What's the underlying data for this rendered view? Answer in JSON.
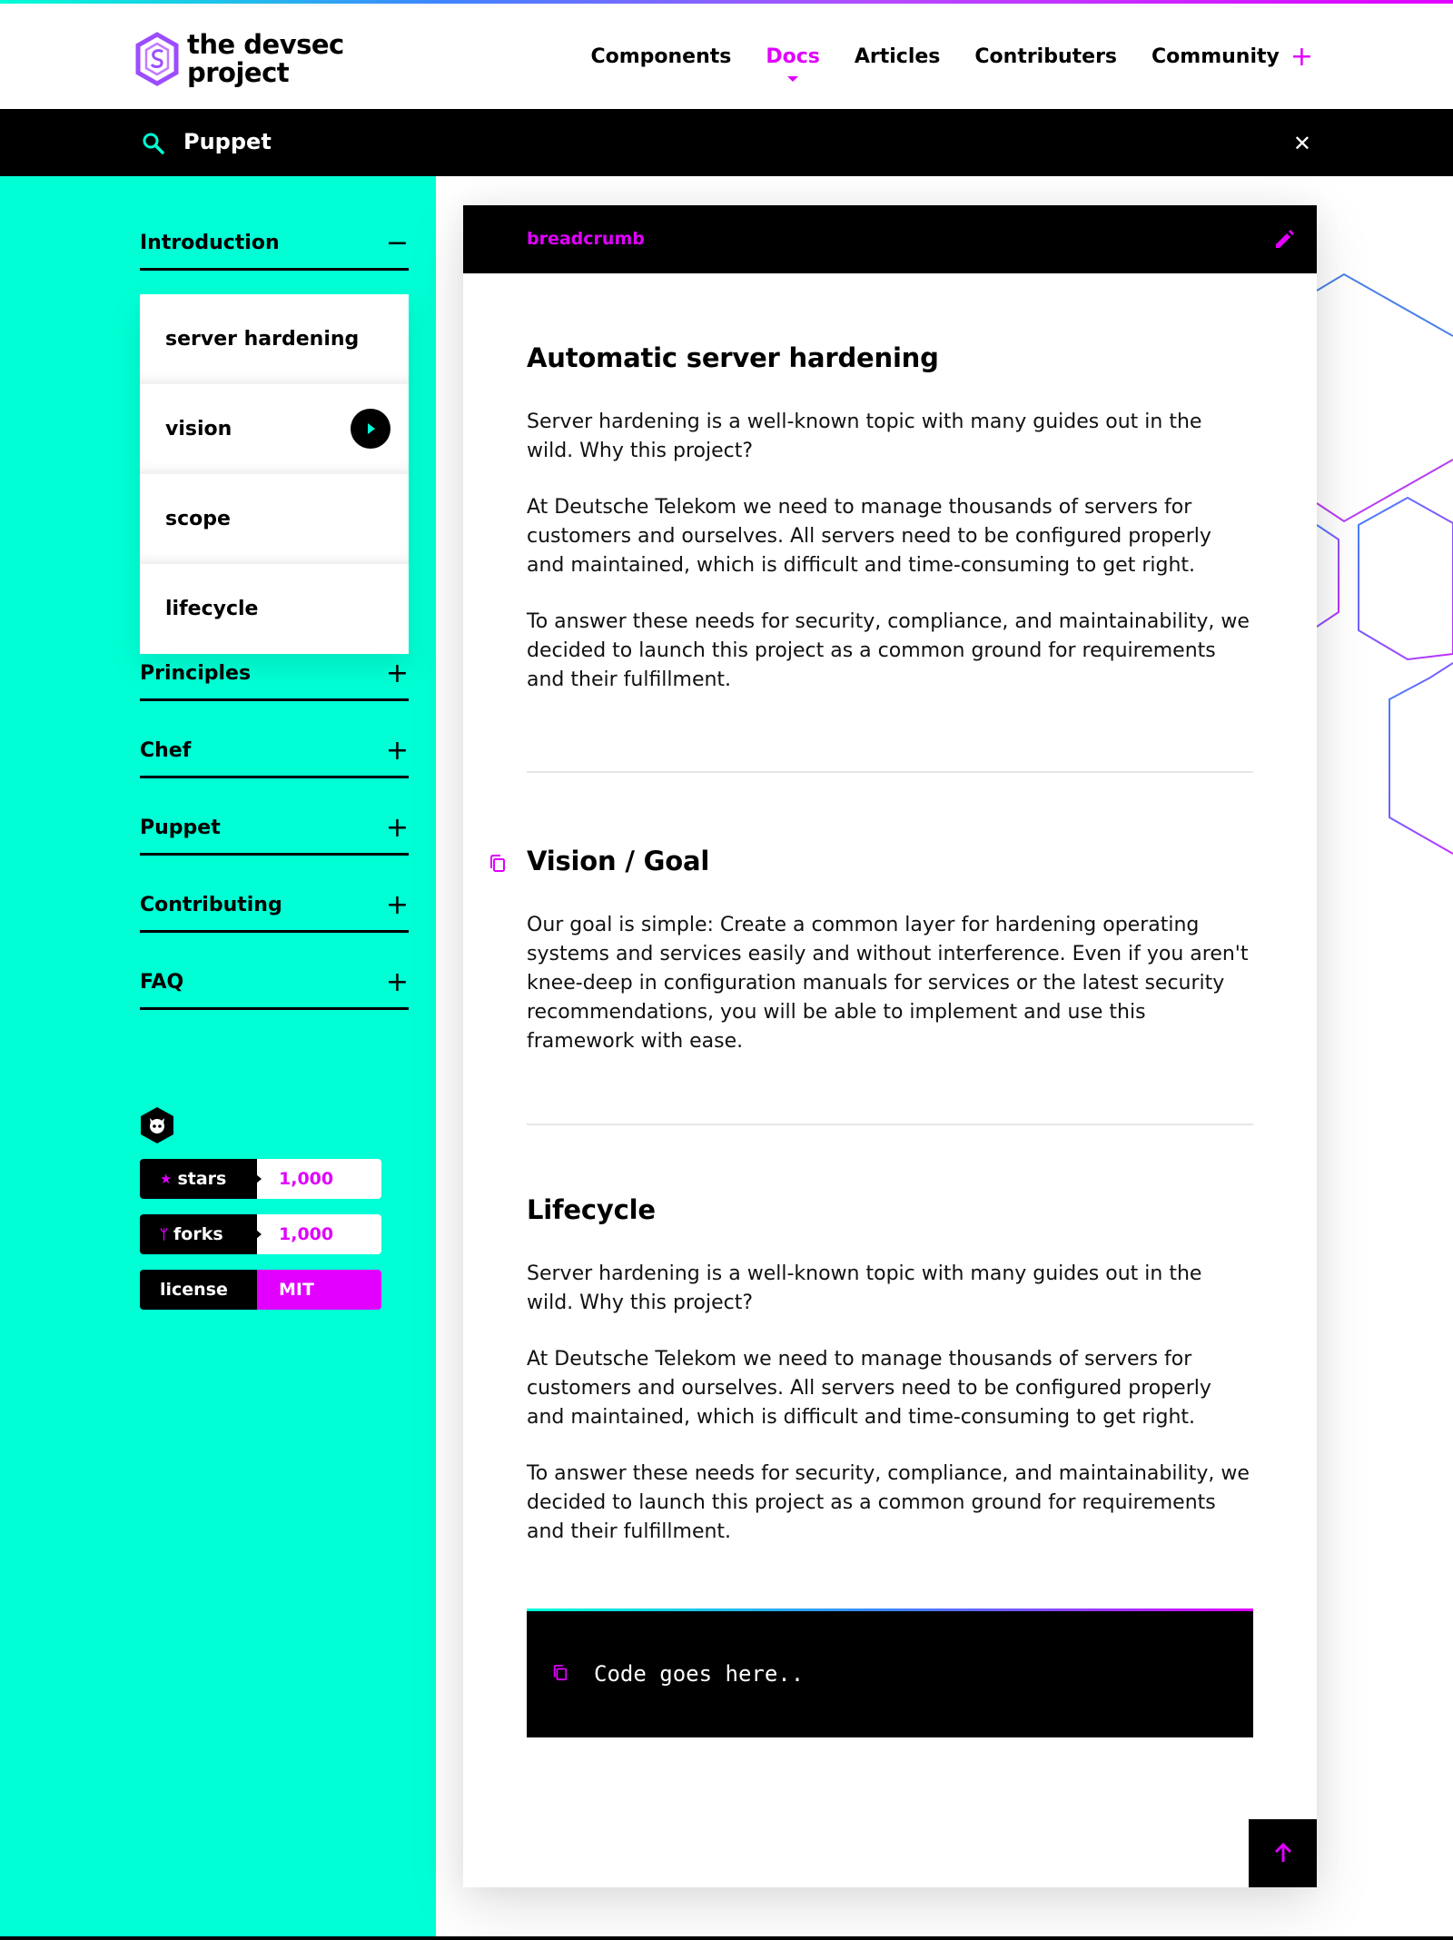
{
  "brand": {
    "name_line1": "the devsec",
    "name_line2": "project",
    "colors": {
      "accent": "#e100ff",
      "teal": "#00ffd5",
      "blue": "#3d86ff"
    }
  },
  "nav": {
    "items": [
      "Components",
      "Docs",
      "Articles",
      "Contributers",
      "Community"
    ],
    "active": "Docs"
  },
  "search": {
    "value": "Puppet"
  },
  "sidebar": {
    "sections": [
      {
        "label": "Introduction",
        "expanded": true
      },
      {
        "label": "Principles",
        "expanded": false
      },
      {
        "label": "Chef",
        "expanded": false
      },
      {
        "label": "Puppet",
        "expanded": false
      },
      {
        "label": "Contributing",
        "expanded": false
      },
      {
        "label": "FAQ",
        "expanded": false
      }
    ],
    "subitems": [
      "server hardening",
      "vision",
      "scope",
      "lifecycle"
    ],
    "active_subitem": "vision",
    "badges": [
      {
        "label": "stars",
        "glyph": "★",
        "value": "1,000"
      },
      {
        "label": "forks",
        "glyph": "ᛘ",
        "value": "1,000"
      },
      {
        "label": "license",
        "glyph": "",
        "value": "MIT"
      }
    ]
  },
  "card": {
    "breadcrumb": "breadcrumb",
    "sections": [
      {
        "title": "Automatic server hardening",
        "paragraphs": [
          "Server hardening is a well-known topic with many guides out in the wild. Why this project?",
          "At Deutsche Telekom we need to manage thousands of servers for customers and ourselves. All servers need to be configured properly and maintained, which is difficult and time-consuming to get right.",
          "To answer these needs for security, compliance, and maintainability, we decided to launch this project as a common ground for requirements and their fulfillment."
        ]
      },
      {
        "title": "Vision / Goal",
        "paragraphs": [
          "Our goal is simple: Create a common layer for hardening operating systems and services easily and without interference. Even if you aren't knee-deep in configuration manuals for services or the latest security recommendations, you will be able to implement and use this framework with ease."
        ]
      },
      {
        "title": "Lifecycle",
        "paragraphs": [
          "Server hardening is a well-known topic with many guides out in the wild. Why this project?",
          "At Deutsche Telekom we need to manage thousands of servers for customers and ourselves. All servers need to be configured properly and maintained, which is difficult and time-consuming to get right.",
          "To answer these needs for security, compliance, and maintainability, we decided to launch this project as a common ground for requirements and their fulfillment."
        ]
      }
    ],
    "code": "Code goes here.."
  }
}
